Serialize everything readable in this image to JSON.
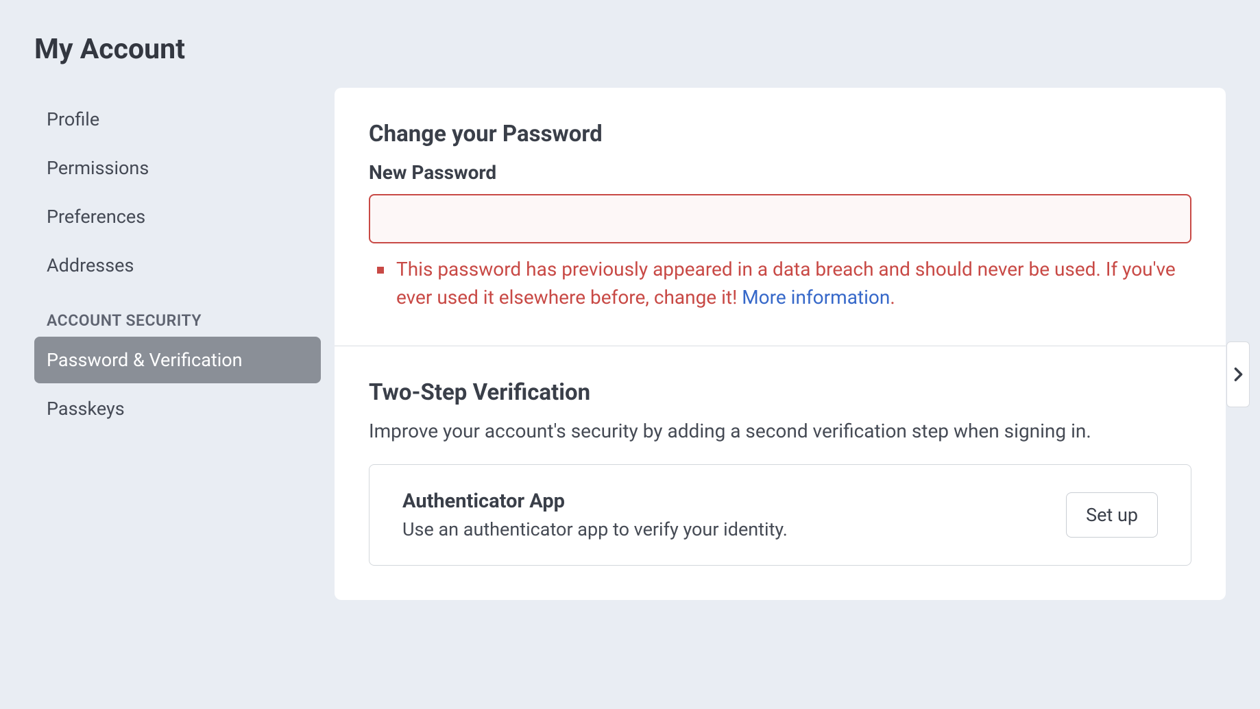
{
  "pageTitle": "My Account",
  "sidebar": {
    "mainItems": [
      {
        "label": "Profile"
      },
      {
        "label": "Permissions"
      },
      {
        "label": "Preferences"
      },
      {
        "label": "Addresses"
      }
    ],
    "sectionHeader": "ACCOUNT SECURITY",
    "securityItems": [
      {
        "label": "Password & Verification",
        "active": true
      },
      {
        "label": "Passkeys",
        "active": false
      }
    ]
  },
  "changePassword": {
    "title": "Change your Password",
    "fieldLabel": "New Password",
    "inputValue": "",
    "errorMessage": "This password has previously appeared in a data breach and should never be used. If you've ever used it elsewhere before, change it! ",
    "errorLinkText": "More information",
    "errorTrailing": "."
  },
  "twoStep": {
    "title": "Two-Step Verification",
    "description": "Improve your account's security by adding a second verification step when signing in.",
    "method": {
      "title": "Authenticator App",
      "subtitle": "Use an authenticator app to verify your identity.",
      "buttonLabel": "Set up"
    }
  }
}
